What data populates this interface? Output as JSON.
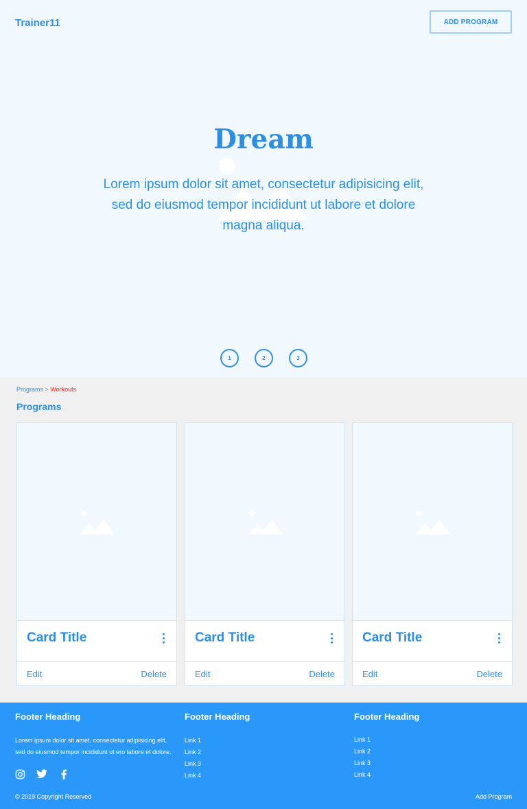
{
  "header": {
    "brand": "Trainer11",
    "add_button": "ADD PROGRAM"
  },
  "hero": {
    "title": "Dream",
    "text": "Lorem ipsum dolor sit amet, consectetur adipisicing elit, sed do eiusmod tempor incididunt ut labore et dolore magna aliqua.",
    "image_icon": "image-placeholder-icon",
    "pagination": [
      "1",
      "2",
      "3"
    ]
  },
  "breadcrumb": {
    "parent": "Programs",
    "separator": ">",
    "current": "Workouts"
  },
  "section_title": "Programs",
  "cards": [
    {
      "title": "Card Title",
      "edit": "Edit",
      "delete": "Delete"
    },
    {
      "title": "Card Title",
      "edit": "Edit",
      "delete": "Delete"
    },
    {
      "title": "Card Title",
      "edit": "Edit",
      "delete": "Delete"
    }
  ],
  "footer": {
    "columns": [
      {
        "heading": "Footer Heading",
        "text": "Lorem ipsum dolor sit amet, consectetur adipisicing elit, sed do eiusmod tempor incididunt ut ero labore et dolore."
      },
      {
        "heading": "Footer Heading",
        "links": [
          "Link 1",
          "Link 2",
          "Link 3",
          "Link 4"
        ]
      },
      {
        "heading": "Footer Heading",
        "links": [
          "Link 1",
          "Link 2",
          "Link 3",
          "Link 4"
        ]
      }
    ],
    "social": [
      "instagram-icon",
      "twitter-icon",
      "facebook-icon"
    ],
    "copyright": "© 2019 Copyright Reserved",
    "add_program": "Add Program"
  },
  "colors": {
    "accent": "#2c8fe6",
    "hero_bg": "#f1f8fe",
    "footer_bg": "#2a98f8",
    "breadcrumb_current": "#e0292a"
  }
}
